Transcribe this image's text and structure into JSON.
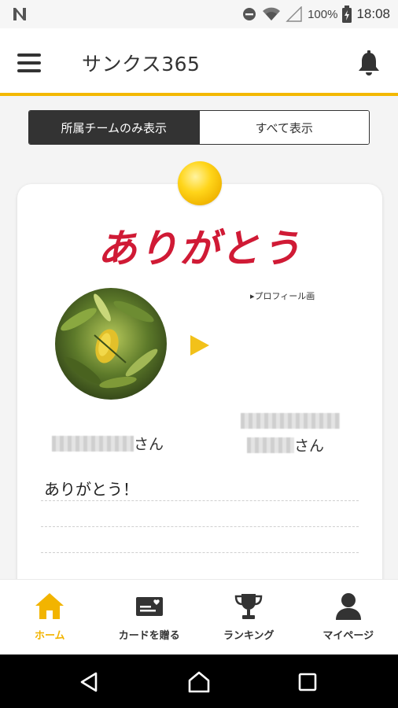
{
  "status_bar": {
    "battery": "100%",
    "time": "18:08"
  },
  "header": {
    "title": "サンクス365"
  },
  "filter": {
    "team_only": "所属チームのみ表示",
    "show_all": "すべて表示"
  },
  "card": {
    "title": "ありがとう",
    "broken_image_alt": "プロフィール画",
    "from_suffix": "さん",
    "to_suffix": "さん",
    "message": "ありがとう！"
  },
  "nav": {
    "home": "ホーム",
    "send_card": "カードを贈る",
    "ranking": "ランキング",
    "mypage": "マイページ"
  },
  "colors": {
    "accent": "#f3b800",
    "title_red": "#d01a35",
    "dark": "#333333"
  }
}
